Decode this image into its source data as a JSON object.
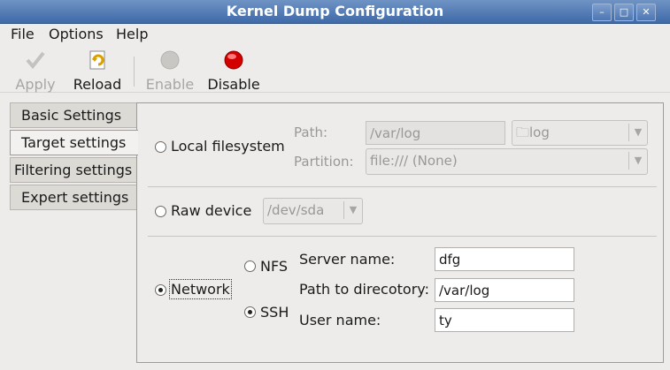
{
  "window": {
    "title": "Kernel Dump Configuration"
  },
  "menu": {
    "file": "File",
    "options": "Options",
    "help": "Help"
  },
  "toolbar": {
    "apply": "Apply",
    "reload": "Reload",
    "enable": "Enable",
    "disable": "Disable"
  },
  "tabs": [
    "Basic Settings",
    "Target settings",
    "Filtering settings",
    "Expert settings"
  ],
  "local": {
    "label": "Local filesystem",
    "path_label": "Path:",
    "path_value": "/var/log",
    "folder_value": "log",
    "partition_label": "Partition:",
    "partition_value": "file:/// (None)"
  },
  "raw": {
    "label": "Raw device",
    "device_value": "/dev/sda"
  },
  "network": {
    "label": "Network",
    "nfs": "NFS",
    "ssh": "SSH",
    "server_label": "Server name:",
    "server_value": "dfg",
    "path_label": "Path to direcotory:",
    "path_value": "/var/log",
    "user_label": "User name:",
    "user_value": "ty"
  },
  "colors": {
    "titlebar": "#4a74b0",
    "disable_icon": "#d40000"
  }
}
